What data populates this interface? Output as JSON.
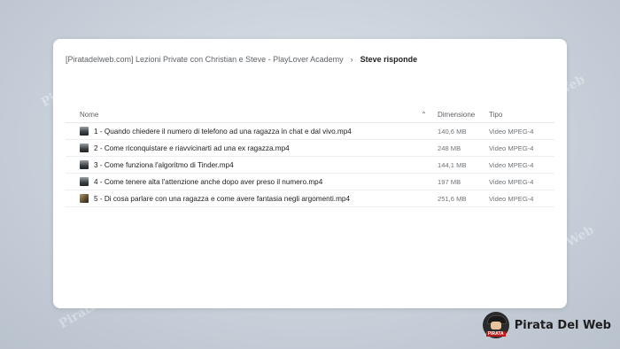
{
  "breadcrumb": {
    "parent": "[Piratadelweb.com] Lezioni Private con Christian e Steve - PlayLover Academy",
    "current": "Steve risponde"
  },
  "table": {
    "headers": {
      "name": "Nome",
      "size": "Dimensione",
      "type": "Tipo"
    },
    "rows": [
      {
        "name": "1 - Quando chiedere il numero di telefono ad una ragazza in chat e dal vivo.mp4",
        "size": "140,6 MB",
        "type": "Video MPEG-4"
      },
      {
        "name": "2 - Come riconquistare e riavvicinarti ad una ex ragazza.mp4",
        "size": "248 MB",
        "type": "Video MPEG-4"
      },
      {
        "name": "3 - Come funziona l'algoritmo di Tinder.mp4",
        "size": "144,1 MB",
        "type": "Video MPEG-4"
      },
      {
        "name": "4 - Come tenere alta l'attenzione anche dopo aver preso il numero.mp4",
        "size": "197 MB",
        "type": "Video MPEG-4"
      },
      {
        "name": "5 - Di cosa parlare con una ragazza e come avere fantasia negli argomenti.mp4",
        "size": "251,6 MB",
        "type": "Video MPEG-4"
      }
    ]
  },
  "logo": {
    "text": "Pirata Del Web",
    "badge": "PIRATA"
  },
  "watermark": "Pirata Del Web"
}
